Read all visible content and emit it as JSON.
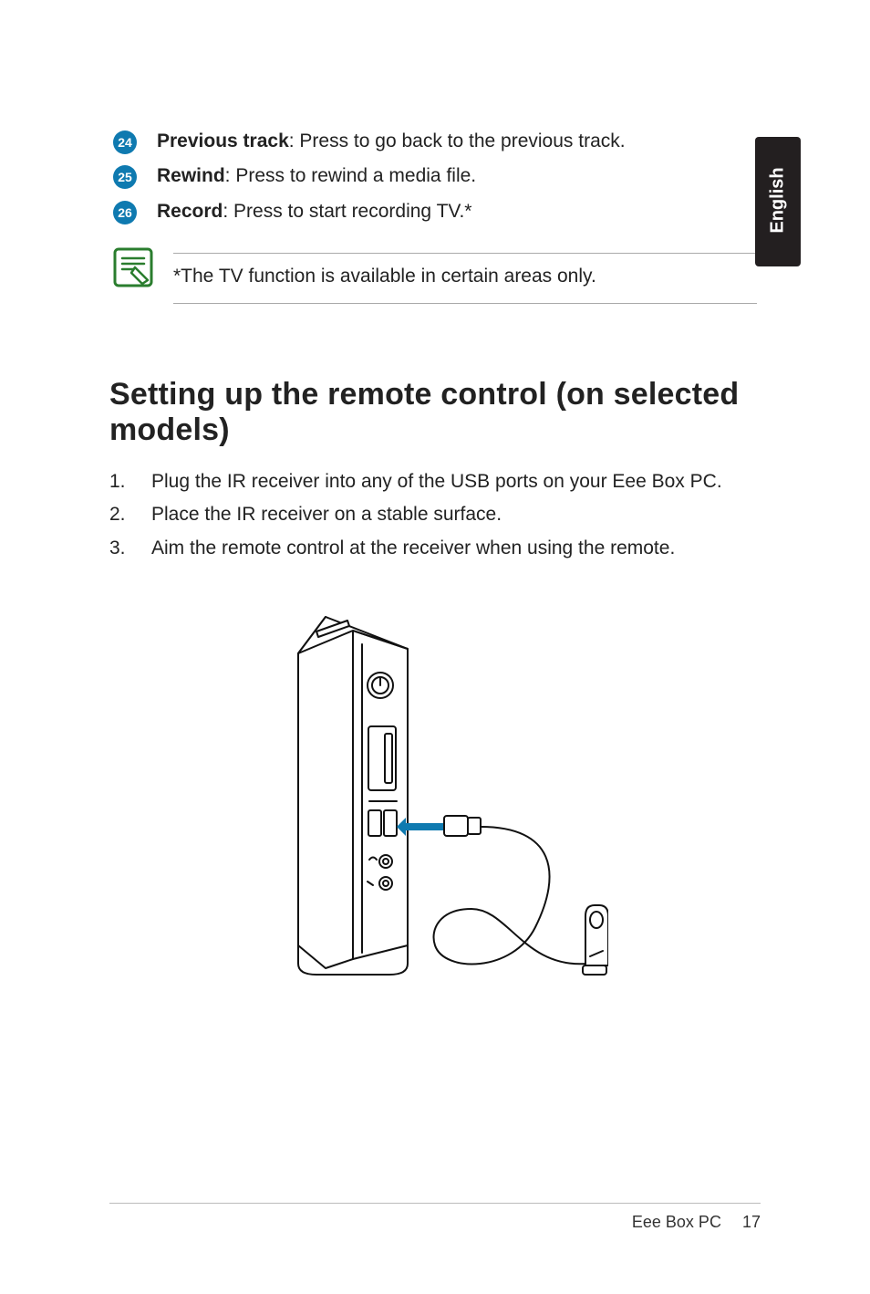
{
  "lang_tab": "English",
  "circ_list": [
    {
      "num": "24",
      "bold": "Previous track",
      "rest": ": Press to go back to the previous track."
    },
    {
      "num": "25",
      "bold": "Rewind",
      "rest": ": Press to rewind a media file."
    },
    {
      "num": "26",
      "bold": "Record",
      "rest": ": Press to start recording TV.*"
    }
  ],
  "note_text": "*The TV function is available in certain areas only.",
  "heading": "Setting up the remote control (on selected models)",
  "steps": [
    {
      "n": "1.",
      "t": "Plug the IR receiver into any of the USB ports on your Eee Box PC."
    },
    {
      "n": "2.",
      "t": "Place the IR receiver on a stable surface."
    },
    {
      "n": "3.",
      "t": "Aim the remote control at the receiver when using the remote."
    }
  ],
  "footer_product": "Eee Box PC",
  "footer_page": "17"
}
